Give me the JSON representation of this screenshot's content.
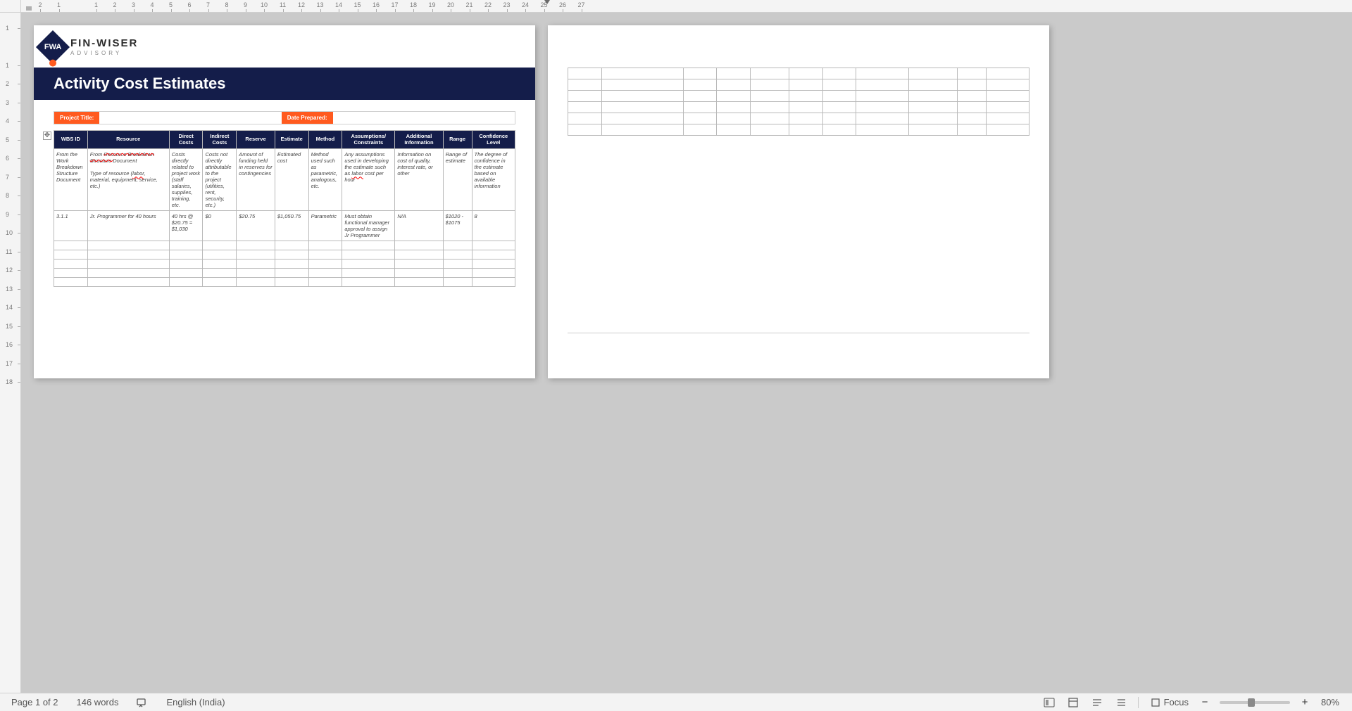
{
  "ruler": {
    "h_numbers": [
      "2",
      "1",
      "1",
      "2",
      "3",
      "4",
      "5",
      "6",
      "7",
      "8",
      "9",
      "10",
      "11",
      "12",
      "13",
      "14",
      "15",
      "16",
      "17",
      "18",
      "19",
      "20",
      "21",
      "22",
      "23",
      "24",
      "25",
      "26",
      "27"
    ],
    "v_numbers": [
      "1",
      "1",
      "2",
      "3",
      "4",
      "5",
      "6",
      "7",
      "8",
      "9",
      "10",
      "11",
      "12",
      "13",
      "14",
      "15",
      "16",
      "17",
      "18"
    ]
  },
  "logo": {
    "main": "FIN-WISER",
    "sub": "ADVISORY",
    "badge": "FWA"
  },
  "title": "Activity Cost Estimates",
  "fields": {
    "project_label": "Project Title:",
    "date_label": "Date Prepared:"
  },
  "table": {
    "headers": [
      "WBS ID",
      "Resource",
      "Direct Costs",
      "Indirect Costs",
      "Reserve",
      "Estimate",
      "Method",
      "Assumptions/ Constraints",
      "Additional Information",
      "Range",
      "Confidence Level"
    ],
    "desc_row": {
      "c0": "From the Work Breakdown Structure Document",
      "c1_a": "From ",
      "c1_b": "Resource Breakdown Structure ",
      "c1_c": "Document",
      "c1_d": "Type of resource (",
      "c1_e": "labor",
      "c1_f": ", material, equipment, service, etc.)",
      "c2": "Costs directly related to project work (staff salaries, supplies, training, etc.",
      "c3": "Costs not directly attributable to the project (utilities, rent, security, etc.)",
      "c4": "Amount of funding held in reserves for contingencies",
      "c5": "Estimated cost",
      "c6": "Method used such as parametric, analogous, etc.",
      "c7_a": "Any assumptions used in developing the estimate such as ",
      "c7_b": "labor",
      "c7_c": " cost per hour",
      "c8": "Information on cost of quality, interest rate, or other",
      "c9": "Range of estimate",
      "c10": "The degree of confidence in the estimate based on available information"
    },
    "data_row": {
      "c0": "3.1.1",
      "c1": "Jr. Programmer for 40 hours",
      "c2": "40 hrs @ $20.75 = $1,030",
      "c3": "$0",
      "c4": "$20.75",
      "c5": "$1,050.75",
      "c6": "Parametric",
      "c7": "Must obtain functional manager approval to assign Jr Programmer",
      "c8": "N/A",
      "c9": "$1020 - $1075",
      "c10": "8"
    }
  },
  "status": {
    "page": "Page 1 of 2",
    "words": "146 words",
    "lang": "English (India)",
    "focus": "Focus",
    "zoom": "80%"
  }
}
